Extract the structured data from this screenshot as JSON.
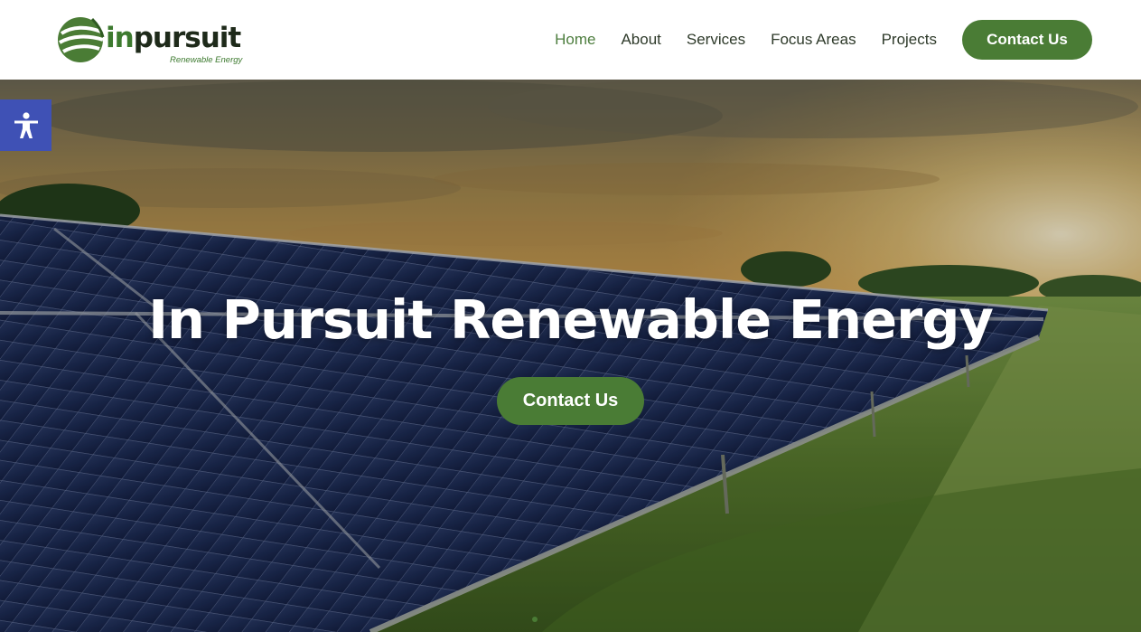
{
  "logo": {
    "wordmark_in": "in",
    "wordmark_rest": "pursuit",
    "tagline": "Renewable Energy"
  },
  "nav": {
    "items": [
      {
        "label": "Home",
        "active": true
      },
      {
        "label": "About",
        "active": false
      },
      {
        "label": "Services",
        "active": false
      },
      {
        "label": "Focus Areas",
        "active": false
      },
      {
        "label": "Projects",
        "active": false
      }
    ],
    "cta_label": "Contact Us"
  },
  "hero": {
    "title": "In Pursuit Renewable Energy",
    "cta_label": "Contact Us",
    "slide_count": 1,
    "active_slide": 1
  },
  "icons": {
    "accessibility": "accessibility-person-icon",
    "logo_mark": "leaf-globe-icon"
  },
  "colors": {
    "brand_green": "#4a7c35",
    "dark_text": "#2e3a2a",
    "accessibility_blue": "#3f51b5",
    "hero_text": "#ffffff"
  }
}
